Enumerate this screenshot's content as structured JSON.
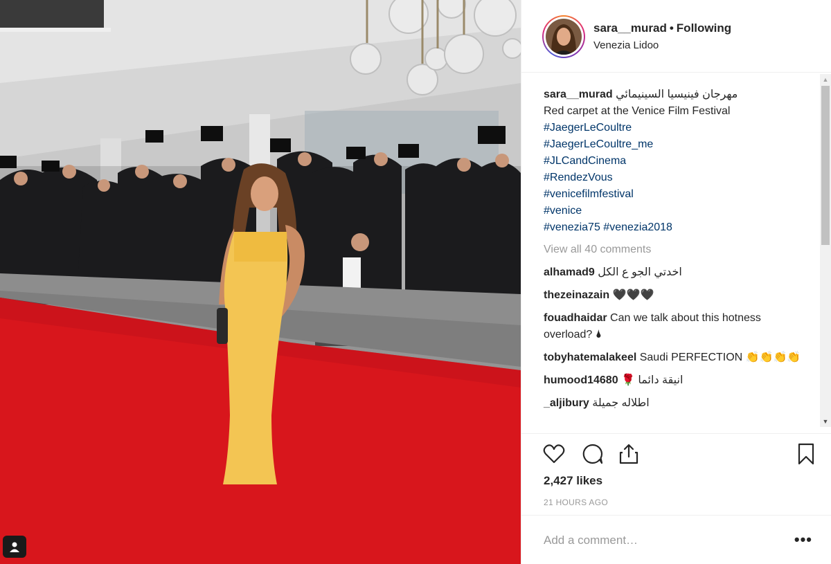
{
  "post": {
    "username": "sara__murad",
    "separator": "•",
    "follow_status": "Following",
    "location": "Venezia Lidoo",
    "caption_arabic": "مهرجان فينيسيا السينيمائي",
    "caption_lines": [
      "Red carpet at the Venice Film Festival"
    ],
    "hashtags": [
      "#JaegerLeCoultre",
      "#JaegerLeCoultre_me",
      "#JLCandCinema",
      "#RendezVous",
      "#venicefilmfestival",
      "#venice",
      "#venezia75 #venezia2018"
    ],
    "view_all_comments": "View all 40 comments",
    "comments": [
      {
        "user": "alhamad9",
        "text": "اخدتي الجو ع الكل"
      },
      {
        "user": "thezeinazain",
        "text": "🖤🖤🖤"
      },
      {
        "user": "fouadhaidar",
        "text": "Can we talk about this hotness overload? 🌢"
      },
      {
        "user": "tobyhatemalakeel",
        "text": "Saudi PERFECTION 👏👏👏👏"
      },
      {
        "user": "humood14680",
        "text": "انيقة دائما 🌹"
      },
      {
        "user": "_aljibury",
        "text": "اطلاله جميلة"
      }
    ],
    "likes": "2,427 likes",
    "time_ago": "21 HOURS AGO",
    "comment_placeholder": "Add a comment…",
    "more_options": "•••"
  },
  "icons": {
    "like": "heart-icon",
    "comment": "comment-icon",
    "share": "share-icon",
    "save": "bookmark-icon",
    "user_tag": "user-tag-icon"
  },
  "colors": {
    "hashtag": "#003569",
    "muted": "#999999",
    "text": "#262626",
    "carpet": "#d8161c",
    "dress": "#f3c553"
  }
}
